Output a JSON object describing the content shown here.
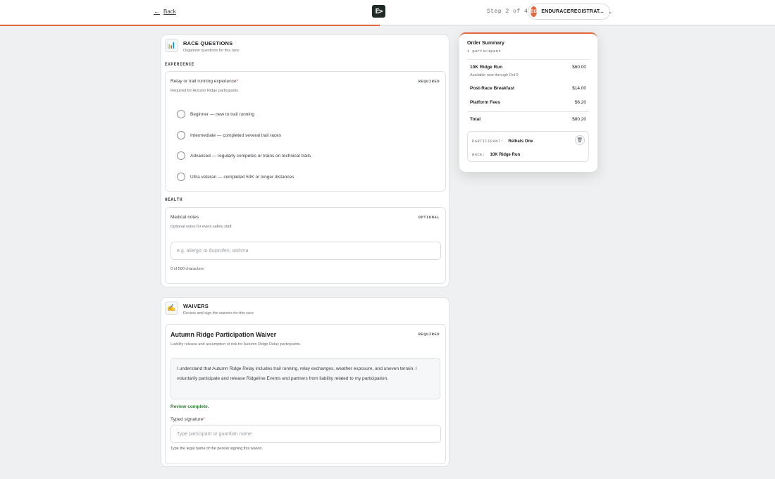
{
  "header": {
    "back_label": "Back",
    "logo_text": "E>",
    "step_text": "Step 2 of 4",
    "progress_fraction": 0.49,
    "account": {
      "initials": "EG",
      "name": "ENDURACEREGISTRAT..."
    }
  },
  "race_questions": {
    "title": "RACE QUESTIONS",
    "subtitle": "Organizer questions for this race",
    "icon": "clipboard-chart-icon",
    "experience": {
      "group_label": "EXPERIENCE",
      "question": "Relay or trail running experience",
      "required_mark": "*",
      "help": "Required for Autumn Ridge participants.",
      "tag": "REQUIRED",
      "options": [
        "Beginner — new to trail running",
        "Intermediate — completed several trail races",
        "Advanced — regularly competes or trains on technical trails",
        "Ultra veteran — completed 50K or longer distances"
      ]
    },
    "health": {
      "group_label": "HEALTH",
      "question": "Medical notes",
      "help": "Optional notes for event safety staff.",
      "tag": "OPTIONAL",
      "placeholder": "e.g. allergic to ibuprofen, asthma",
      "value": "",
      "counter": "0 of 500 characters"
    }
  },
  "waivers": {
    "title": "WAIVERS",
    "subtitle": "Review and sign the waivers for this race",
    "icon": "signing-hand-icon",
    "waiver": {
      "title": "Autumn Ridge Participation Waiver",
      "tag": "REQUIRED",
      "description": "Liability release and assumption of risk for Autumn Ridge Relay participants.",
      "body": "I understand that Autumn Ridge Relay includes trail running, relay exchanges, weather exposure, and uneven terrain. I voluntarily participate and release Ridgeline Events and partners from liability related to my participation.",
      "review_status": "Review complete.",
      "signature_label": "Typed signature",
      "required_mark": "*",
      "signature_placeholder": "Type participant or guardian name",
      "signature_help": "Type the legal name of the person signing this waiver."
    }
  },
  "order_summary": {
    "title": "Order Summary",
    "subtitle": "1 participant",
    "items": [
      {
        "label": "10K Ridge Run",
        "amount": "$60.00",
        "note": "Available now through Oct 9"
      },
      {
        "label": "Post-Race Breakfast",
        "amount": "$14.00"
      },
      {
        "label": "Platform Fees",
        "amount": "$6.20"
      }
    ],
    "total_label": "Total",
    "total_amount": "$80.20",
    "participant": {
      "participant_key": "PARTICIPANT:",
      "participant_name": "Relhats One",
      "race_key": "RACE:",
      "race_name": "10K Ridge Run"
    }
  }
}
